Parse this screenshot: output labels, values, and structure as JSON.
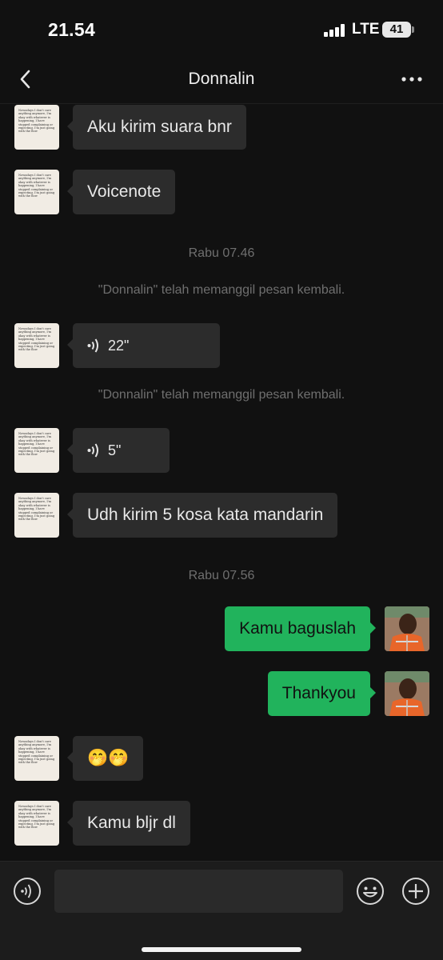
{
  "status_bar": {
    "time": "21.54",
    "network": "LTE",
    "battery": "41"
  },
  "header": {
    "title": "Donnalin"
  },
  "avatar_them_text": "Nowadays I don't care anything anymore, I'm okay with whatever is happening, I have stopped complaining or expecting. I'm just going with the flow",
  "messages": {
    "m1": "Aku kirim suara bnr",
    "m2": "Voicenote",
    "ts1": "Rabu 07.46",
    "sys1": "\"Donnalin\" telah memanggil pesan kembali.",
    "v1": "22\"",
    "sys2": "\"Donnalin\" telah memanggil pesan kembali.",
    "v2": "5\"",
    "m3": "Udh kirim 5 kosa kata mandarin",
    "ts2": "Rabu 07.56",
    "me1": "Kamu baguslah",
    "me2": "Thankyou",
    "m4": "🤭🤭",
    "m5": "Kamu bljr dl"
  },
  "icons": {
    "back": "chevron-left-icon",
    "more": "more-dots-icon",
    "voice": "voice-wave-icon",
    "emoji": "emoji-face-icon",
    "plus": "plus-circle-icon"
  },
  "colors": {
    "background": "#111111",
    "bubble_them": "#2c2c2c",
    "bubble_me": "#21b35c",
    "system_text": "#6f6f6f"
  }
}
